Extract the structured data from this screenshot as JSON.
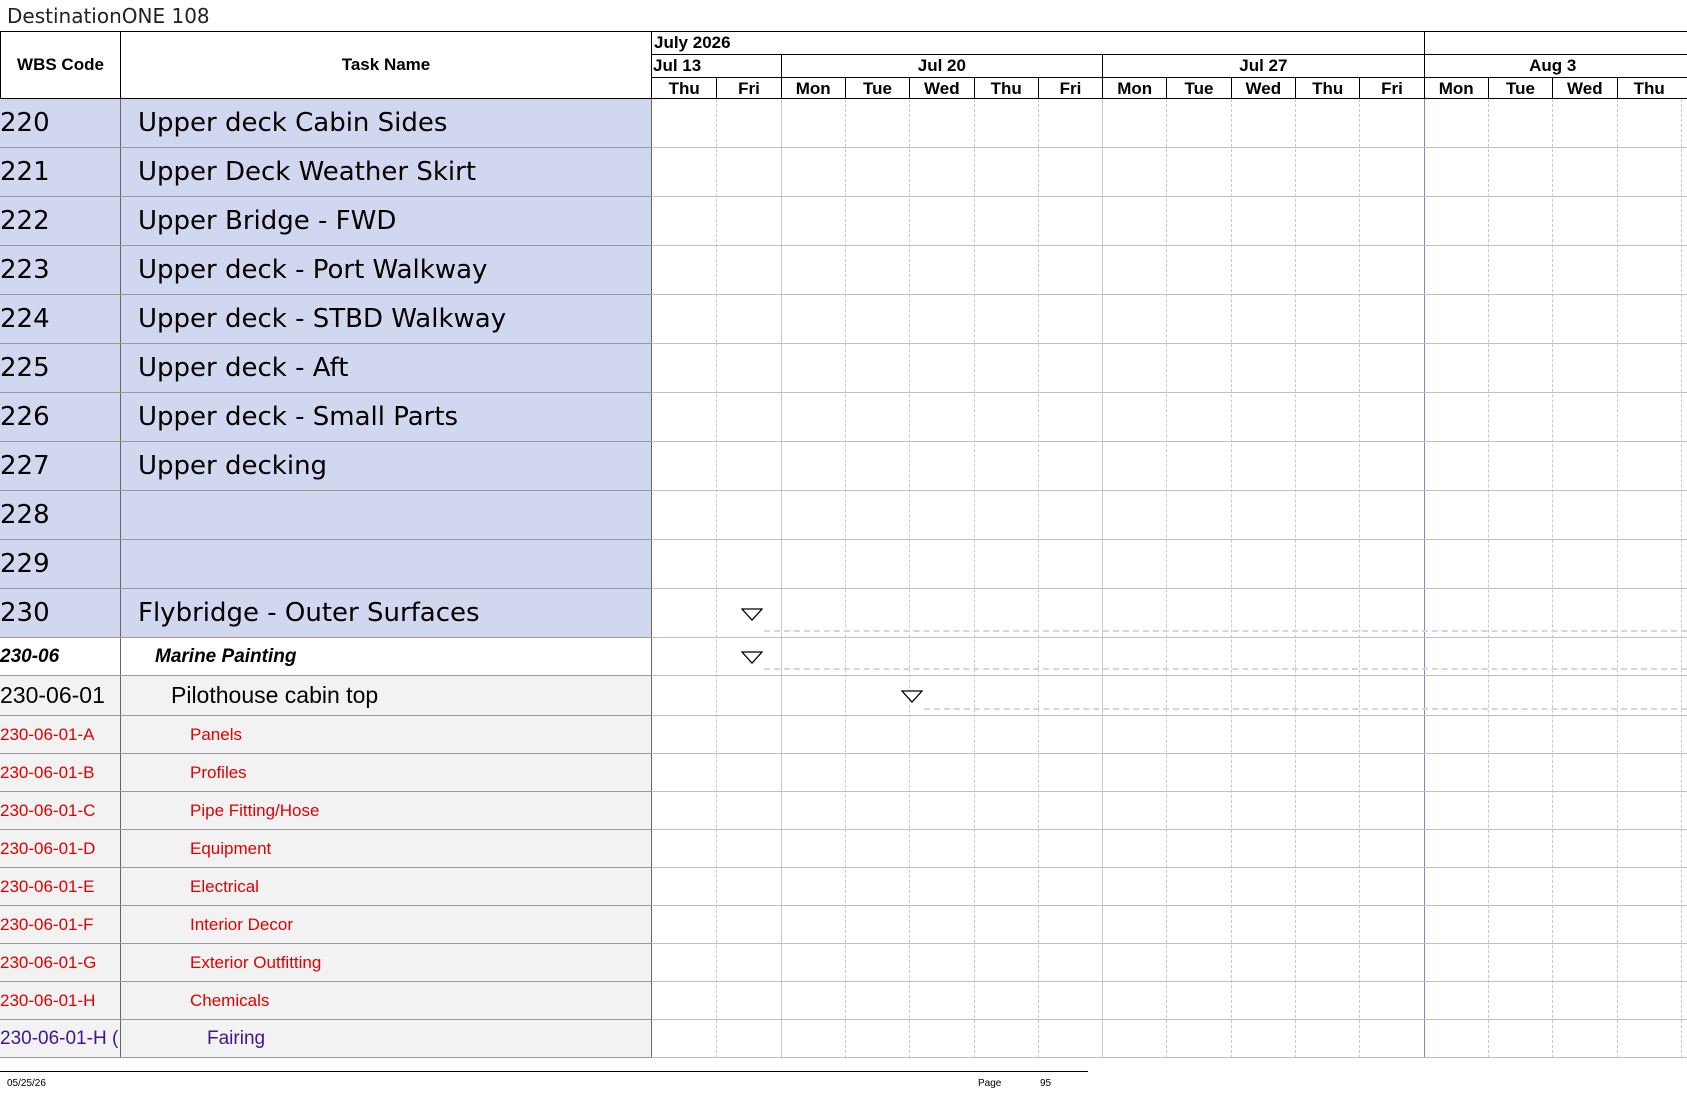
{
  "document": {
    "title": "DestinationONE 108"
  },
  "columns": {
    "wbs": "WBS Code",
    "task": "Task Name"
  },
  "timeline": {
    "month": "July 2026",
    "weeks": [
      "Jul 13",
      "Jul 20",
      "Jul 27",
      "Aug 3"
    ],
    "days": [
      "Thu",
      "Fri",
      "Mon",
      "Tue",
      "Wed",
      "Thu",
      "Fri",
      "Mon",
      "Tue",
      "Wed",
      "Thu",
      "Fri",
      "Mon",
      "Tue",
      "Wed",
      "Thu"
    ]
  },
  "rows": [
    {
      "wbs": "220",
      "task": "Upper deck Cabin Sides",
      "level": 1
    },
    {
      "wbs": "221",
      "task": "Upper Deck Weather Skirt",
      "level": 1
    },
    {
      "wbs": "222",
      "task": "Upper Bridge - FWD",
      "level": 1
    },
    {
      "wbs": "223",
      "task": "Upper deck - Port Walkway",
      "level": 1
    },
    {
      "wbs": "224",
      "task": "Upper deck - STBD Walkway",
      "level": 1
    },
    {
      "wbs": "225",
      "task": "Upper deck  - Aft",
      "level": 1
    },
    {
      "wbs": "226",
      "task": "Upper deck - Small Parts",
      "level": 1
    },
    {
      "wbs": "227",
      "task": "Upper decking",
      "level": 1
    },
    {
      "wbs": "228",
      "task": "",
      "level": 1
    },
    {
      "wbs": "229",
      "task": "",
      "level": 1
    },
    {
      "wbs": "230",
      "task": "Flybridge - Outer Surfaces",
      "level": 1
    },
    {
      "wbs": "230-06",
      "task": "Marine Painting",
      "level": 2
    },
    {
      "wbs": "230-06-01",
      "task": "Pilothouse cabin top",
      "level": 3
    },
    {
      "wbs": "230-06-01-A",
      "task": "Panels",
      "level": 4
    },
    {
      "wbs": "230-06-01-B",
      "task": "Profiles",
      "level": 4
    },
    {
      "wbs": "230-06-01-C",
      "task": "Pipe Fitting/Hose",
      "level": 4
    },
    {
      "wbs": "230-06-01-D",
      "task": "Equipment",
      "level": 4
    },
    {
      "wbs": "230-06-01-E",
      "task": "Electrical",
      "level": 4
    },
    {
      "wbs": "230-06-01-F",
      "task": "Interior Decor",
      "level": 4
    },
    {
      "wbs": "230-06-01-G",
      "task": "Exterior Outfitting",
      "level": 4
    },
    {
      "wbs": "230-06-01-H",
      "task": "Chemicals",
      "level": 4
    },
    {
      "wbs": "230-06-01-H (",
      "task": "Fairing",
      "level": 5
    }
  ],
  "footer": {
    "date": "05/25/26",
    "page_label": "Page",
    "page_number": "95"
  }
}
